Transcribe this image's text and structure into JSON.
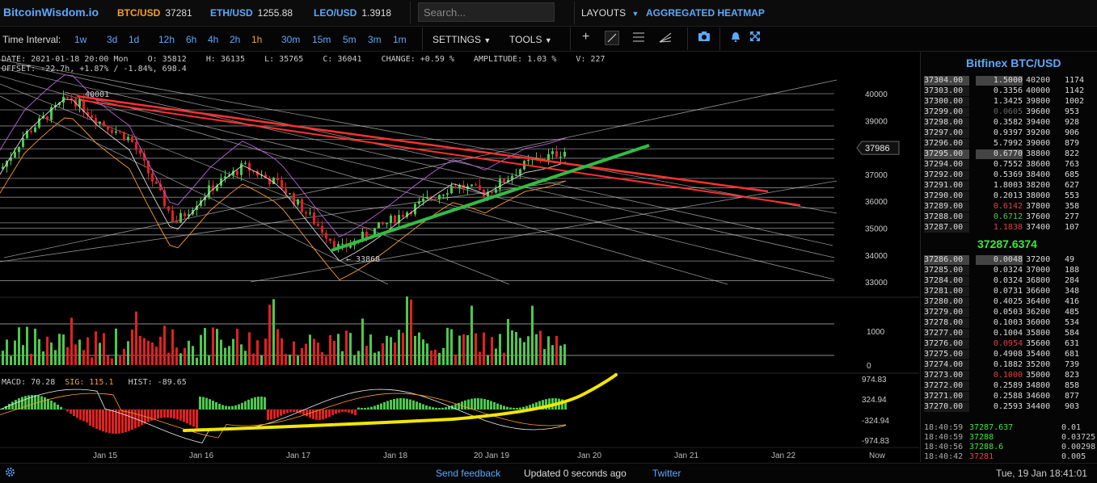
{
  "header": {
    "logo": "BitcoinWisdom.io",
    "tickers": [
      {
        "symbol": "BTC/USD",
        "price": "37281"
      },
      {
        "symbol": "ETH/USD",
        "price": "1255.88"
      },
      {
        "symbol": "LEO/USD",
        "price": "1.3918"
      }
    ],
    "search_placeholder": "Search...",
    "layouts_label": "LAYOUTS",
    "heatmap_label": "AGGREGATED HEATMAP"
  },
  "toolbar": {
    "time_interval_label": "Time Interval:",
    "intervals": [
      "1w",
      "3d",
      "1d",
      "12h",
      "6h",
      "4h",
      "2h",
      "1h",
      "30m",
      "15m",
      "5m",
      "3m",
      "1m"
    ],
    "active_interval": "1h",
    "settings_label": "SETTINGS",
    "tools_label": "TOOLS",
    "icons": [
      "plus-icon",
      "line-draw-icon",
      "horizontal-lines-icon",
      "fan-icon",
      "camera-icon",
      "bell-icon",
      "fullscreen-icon"
    ]
  },
  "info": {
    "line1": "DATE: 2021-01-18 20:00 Mon    O: 35812    H: 36135    L: 35765    C: 36041    CHANGE: +0.59 %    AMPLITUDE: 1.03 %    V: 227",
    "line2": "OFFSET: -22.7h, +1.87% / -1.84%, 698.4",
    "macd_label": "MACD: 70.28",
    "sig_label": "SIG: 115.1",
    "hist_label": "HIST: -89.65"
  },
  "chart_data": {
    "type": "candlestick",
    "price_axis": [
      "40000",
      "39000",
      "38000",
      "37000",
      "36000",
      "35000",
      "34000",
      "33000"
    ],
    "current_price_tag": "37986",
    "high_annotation": "40001",
    "low_annotation": "33868",
    "volume_axis": [
      "1000",
      "0"
    ],
    "macd_axis": [
      "974.83",
      "324.94",
      "-324.94",
      "-974.83"
    ],
    "time_axis": [
      "Jan 15",
      "Jan 16",
      "Jan 17",
      "Jan 18",
      "20",
      "Jan 19",
      "Jan 20",
      "Jan 21",
      "Jan 22",
      "Now"
    ],
    "colors": {
      "up": "#4cc84c",
      "down": "#e32020",
      "trend_red": "#ff3030",
      "trend_green": "#33bb44",
      "curve_yellow": "#f2e600"
    }
  },
  "orderbook": {
    "title": "Bitfinex BTC/USD",
    "asks": [
      {
        "price": "37304.00",
        "amount": "1.5000",
        "dp": "40200",
        "dv": "1174"
      },
      {
        "price": "37303.00",
        "amount": "0.3356",
        "dp": "40000",
        "dv": "1142"
      },
      {
        "price": "37300.00",
        "amount": "1.3425",
        "dp": "39800",
        "dv": "1002"
      },
      {
        "price": "37299.00",
        "amount": "0.0605",
        "dp": "39600",
        "dv": "953"
      },
      {
        "price": "37298.00",
        "amount": "0.3582",
        "dp": "39400",
        "dv": "928"
      },
      {
        "price": "37297.00",
        "amount": "0.9397",
        "dp": "39200",
        "dv": "906"
      },
      {
        "price": "37296.00",
        "amount": "5.7992",
        "dp": "39000",
        "dv": "879"
      },
      {
        "price": "37295.00",
        "amount": "0.6770",
        "dp": "38800",
        "dv": "822"
      },
      {
        "price": "37294.00",
        "amount": "0.7552",
        "dp": "38600",
        "dv": "763"
      },
      {
        "price": "37292.00",
        "amount": "0.5369",
        "dp": "38400",
        "dv": "685"
      },
      {
        "price": "37291.00",
        "amount": "1.8003",
        "dp": "38200",
        "dv": "627"
      },
      {
        "price": "37290.00",
        "amount": "0.2013",
        "dp": "38000",
        "dv": "553"
      },
      {
        "price": "37289.00",
        "amount": "0.6142",
        "dp": "37800",
        "dv": "358"
      },
      {
        "price": "37288.00",
        "amount": "0.6712",
        "dp": "37600",
        "dv": "277"
      },
      {
        "price": "37287.00",
        "amount": "1.1838",
        "dp": "37400",
        "dv": "107"
      }
    ],
    "last_price": "37287.6374",
    "bids": [
      {
        "price": "37286.00",
        "amount": "0.0048",
        "dp": "37200",
        "dv": "49"
      },
      {
        "price": "37285.00",
        "amount": "0.0324",
        "dp": "37000",
        "dv": "188"
      },
      {
        "price": "37284.00",
        "amount": "0.0324",
        "dp": "36800",
        "dv": "284"
      },
      {
        "price": "37281.00",
        "amount": "0.0731",
        "dp": "36600",
        "dv": "348"
      },
      {
        "price": "37280.00",
        "amount": "0.4025",
        "dp": "36400",
        "dv": "416"
      },
      {
        "price": "37279.00",
        "amount": "0.0503",
        "dp": "36200",
        "dv": "485"
      },
      {
        "price": "37278.00",
        "amount": "0.1003",
        "dp": "36000",
        "dv": "534"
      },
      {
        "price": "37277.00",
        "amount": "0.1004",
        "dp": "35800",
        "dv": "584"
      },
      {
        "price": "37276.00",
        "amount": "0.0954",
        "dp": "35600",
        "dv": "631"
      },
      {
        "price": "37275.00",
        "amount": "0.4908",
        "dp": "35400",
        "dv": "681"
      },
      {
        "price": "37274.00",
        "amount": "0.1882",
        "dp": "35200",
        "dv": "739"
      },
      {
        "price": "37273.00",
        "amount": "0.1000",
        "dp": "35000",
        "dv": "823"
      },
      {
        "price": "37272.00",
        "amount": "0.2589",
        "dp": "34800",
        "dv": "858"
      },
      {
        "price": "37271.00",
        "amount": "0.2588",
        "dp": "34600",
        "dv": "877"
      },
      {
        "price": "37270.00",
        "amount": "0.2593",
        "dp": "34400",
        "dv": "903"
      }
    ],
    "trades": [
      {
        "time": "18:40:59",
        "price": "37287.637",
        "amount": "0.01"
      },
      {
        "time": "18:40:59",
        "price": "37288",
        "amount": "0.03725"
      },
      {
        "time": "18:40:56",
        "price": "37288.6",
        "amount": "0.00298"
      },
      {
        "time": "18:40:42",
        "price": "37281",
        "amount": "0.005"
      }
    ]
  },
  "footer": {
    "feedback": "Send feedback",
    "updated": "Updated 0 seconds ago",
    "twitter": "Twitter",
    "datetime": "Tue, 19 Jan 18:41:01"
  }
}
